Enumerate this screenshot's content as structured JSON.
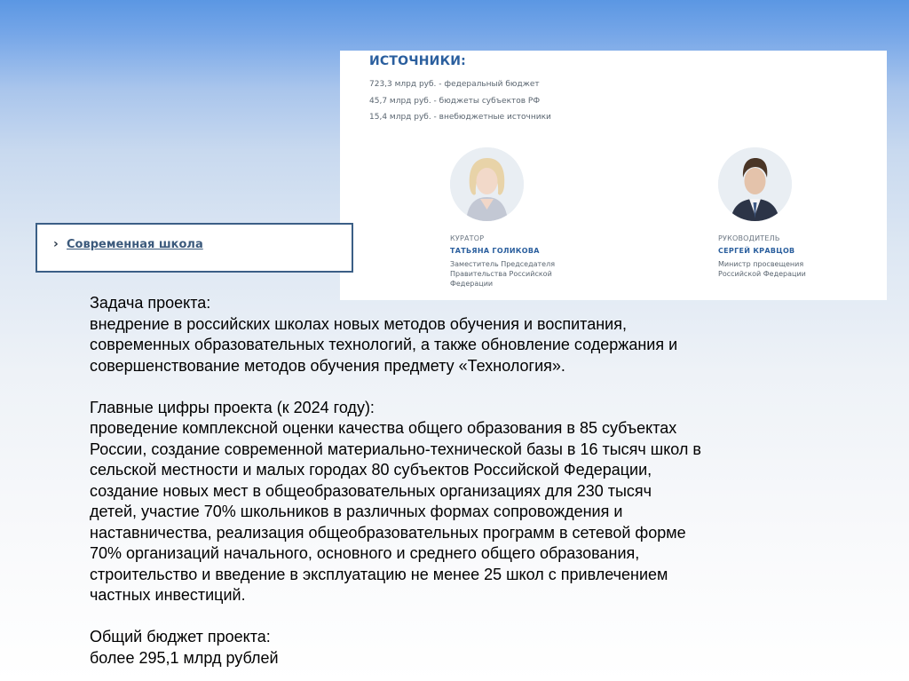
{
  "sources": {
    "title": "ИСТОЧНИКИ:",
    "items": [
      "723,3 млрд руб. - федеральный бюджет",
      "45,7 млрд руб. - бюджеты субъектов РФ",
      "15,4 млрд руб. - внебюджетные источники"
    ]
  },
  "people": [
    {
      "role": "КУРАТОР",
      "name": "ТАТЬЯНА ГОЛИКОВА",
      "description": "Заместитель Председателя\nПравительства Российской\nФедерации"
    },
    {
      "role": "РУКОВОДИТЕЛЬ",
      "name": "СЕРГЕЙ КРАВЦОВ",
      "description": "Министр просвещения\nРоссийской Федерации"
    }
  ],
  "nav": {
    "chevron": "›",
    "link_label": "Современная школа"
  },
  "task": {
    "heading": "Задача проекта:",
    "lines": [
      "внедрение в российских школах новых методов обучения и воспитания,",
      "современных образовательных технологий, а также обновление содержания и",
      "совершенствование методов обучения предмету «Технология»."
    ]
  },
  "figures": {
    "heading": "Главные цифры проекта (к 2024 году):",
    "lines": [
      "проведение комплексной оценки качества общего образования в 85 субъектах",
      "России, создание современной материально-технической базы в 16 тысяч школ в",
      "сельской местности и малых городах 80 субъектов Российской Федерации,",
      "создание новых мест в общеобразовательных организациях для 230 тысяч",
      "детей, участие 70% школьников в различных формах сопровождения и",
      "наставничества, реализация общеобразовательных программ в сетевой форме",
      "70% организаций начального, основного и среднего общего образования,",
      "строительство и введение в эксплуатацию не менее 25 школ с привлечением",
      "частных инвестиций."
    ]
  },
  "budget": {
    "heading": "Общий бюджет проекта:",
    "value": "более 295,1 млрд рублей"
  }
}
